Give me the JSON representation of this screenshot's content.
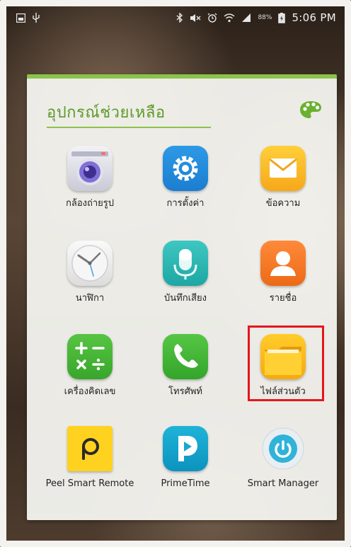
{
  "status_bar": {
    "left_icons": [
      "gallery-icon",
      "usb-icon"
    ],
    "right_icons": [
      "bluetooth-icon",
      "mute-icon",
      "alarm-icon",
      "wifi-icon",
      "signal-icon"
    ],
    "battery_percent": "88%",
    "time": "5:06 PM"
  },
  "folder": {
    "title": "อุปกรณ์ช่วยเหลือ",
    "accent_color": "#8bc34a",
    "apps": [
      {
        "label": "กล้องถ่ายรูป",
        "icon": "camera-icon"
      },
      {
        "label": "การตั้งค่า",
        "icon": "settings-icon"
      },
      {
        "label": "ข้อความ",
        "icon": "messages-icon"
      },
      {
        "label": "นาฬิกา",
        "icon": "clock-icon"
      },
      {
        "label": "บันทึกเสียง",
        "icon": "voice-recorder-icon"
      },
      {
        "label": "รายชื่อ",
        "icon": "contacts-icon"
      },
      {
        "label": "เครื่องคิดเลข",
        "icon": "calculator-icon"
      },
      {
        "label": "โทรศัพท์",
        "icon": "phone-icon"
      },
      {
        "label": "ไฟล์ส่วนตัว",
        "icon": "my-files-icon"
      },
      {
        "label": "Peel Smart Remote",
        "icon": "peel-remote-icon"
      },
      {
        "label": "PrimeTime",
        "icon": "primetime-icon"
      },
      {
        "label": "Smart Manager",
        "icon": "smart-manager-icon"
      }
    ]
  },
  "highlight_color": "#e5161b"
}
